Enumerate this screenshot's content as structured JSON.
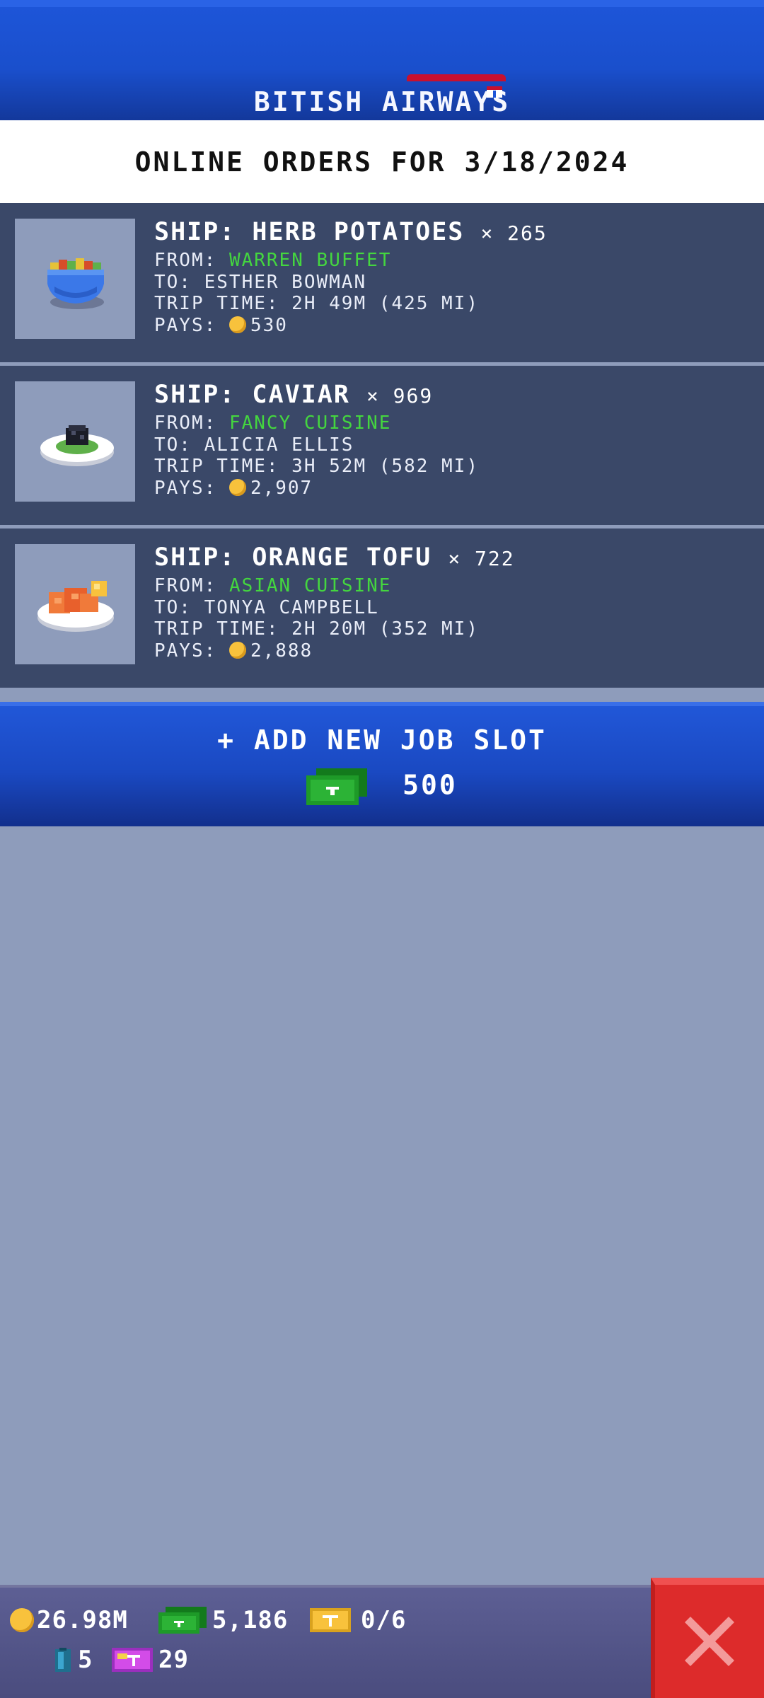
{
  "header": {
    "airline_name": "BITISH AIRWAYS"
  },
  "orders_title": "ONLINE ORDERS FOR 3/18/2024",
  "jobs": [
    {
      "ship_label": "SHIP: HERB POTATOES",
      "quantity": "× 265",
      "from_label": "FROM:",
      "from_value": "WARREN BUFFET",
      "to": "TO: ESTHER BOWMAN",
      "trip_time": "TRIP TIME: 2H 49M (425 MI)",
      "pays_label": "PAYS:",
      "pays_value": "530",
      "icon": "herb-potatoes-bowl-icon"
    },
    {
      "ship_label": "SHIP: CAVIAR",
      "quantity": "× 969",
      "from_label": "FROM:",
      "from_value": "FANCY CUISINE",
      "to": "TO: ALICIA ELLIS",
      "trip_time": "TRIP TIME: 3H 52M (582 MI)",
      "pays_label": "PAYS:",
      "pays_value": "2,907",
      "icon": "caviar-plate-icon"
    },
    {
      "ship_label": "SHIP: ORANGE TOFU",
      "quantity": "× 722",
      "from_label": "FROM:",
      "from_value": "ASIAN CUISINE",
      "to": "TO: TONYA CAMPBELL",
      "trip_time": "TRIP TIME: 2H 20M (352 MI)",
      "pays_label": "PAYS:",
      "pays_value": "2,888",
      "icon": "orange-tofu-plate-icon"
    }
  ],
  "add_slot": {
    "label": "+ ADD NEW JOB SLOT",
    "cost": "500",
    "cost_icon": "cash-bill-icon"
  },
  "status": {
    "coins": "26.98M",
    "cash": "5,186",
    "tickets": "0/6",
    "fuel": "5",
    "gems": "29"
  },
  "colors": {
    "accent_blue": "#1d55d8",
    "card_bg": "#3a4868",
    "page_bg": "#8e9cbb",
    "from_green": "#44d63f",
    "close_red": "#dd2b2b",
    "coin_gold": "#f8c23c"
  }
}
